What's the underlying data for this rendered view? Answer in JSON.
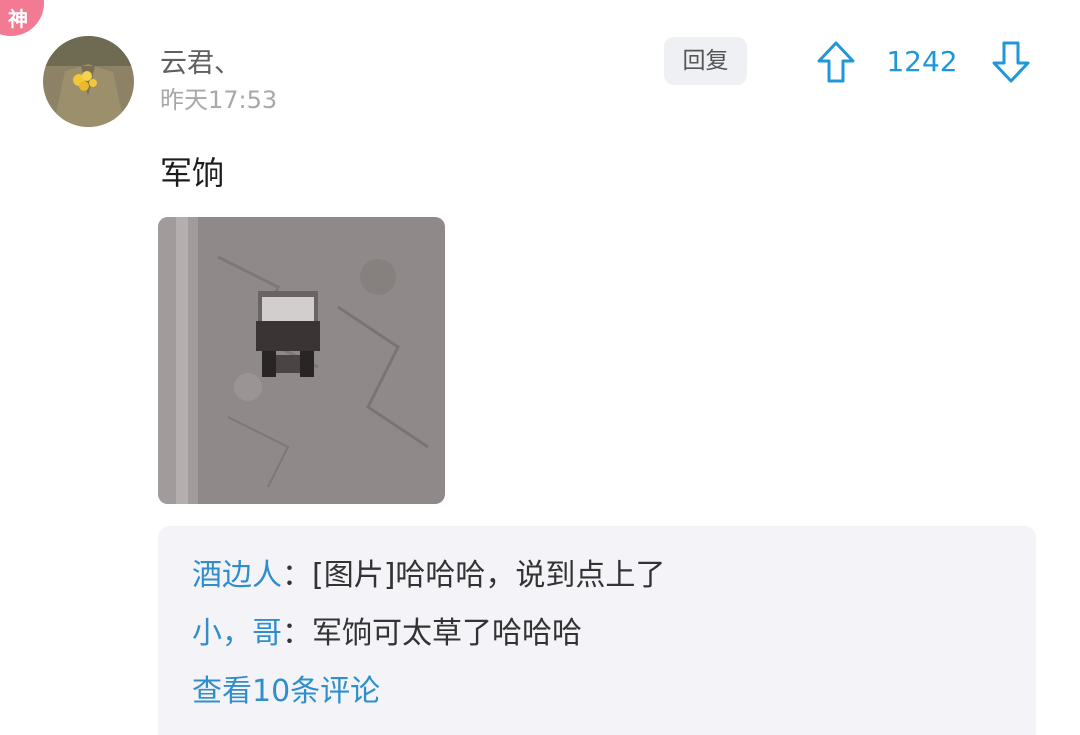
{
  "badge": {
    "label": "神",
    "color": "#f27b93"
  },
  "post": {
    "username": "云君、",
    "timestamp": "昨天17:53",
    "reply_label": "回复",
    "vote_count": "1242",
    "content": "军饷",
    "accent_color": "#1f97d8"
  },
  "comments": {
    "items": [
      {
        "author": "酒边人",
        "separator": "：",
        "text": "[图片]哈哈哈，说到点上了"
      },
      {
        "author": "小，哥",
        "separator": "：",
        "text": "军饷可太草了哈哈哈"
      }
    ],
    "view_more": "查看10条评论",
    "link_color": "#2f8ecb"
  },
  "icons": {
    "upvote": "arrow-up-outline-icon",
    "downvote": "arrow-down-outline-icon"
  }
}
